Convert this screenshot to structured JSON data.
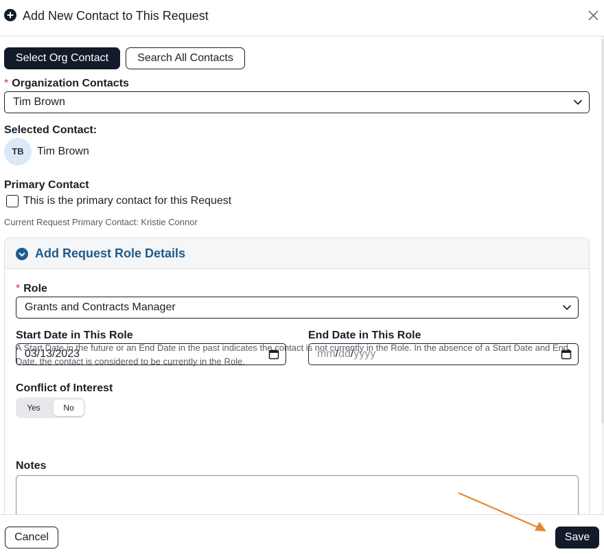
{
  "header": {
    "title": "Add New Contact to This Request",
    "plus_icon": "plus-circle-icon",
    "close_icon": "close-icon"
  },
  "tabs": {
    "select_org": "Select Org Contact",
    "search_all": "Search All Contacts"
  },
  "org_contacts": {
    "required_mark": "*",
    "label": "Organization Contacts",
    "value": "Tim Brown"
  },
  "selected_contact": {
    "label": "Selected Contact:",
    "initials": "TB",
    "name": "Tim Brown"
  },
  "primary_contact": {
    "label": "Primary Contact",
    "checkbox_label": "This is the primary contact for this Request",
    "checked": false,
    "current_note": "Current Request Primary Contact: Kristie Connor"
  },
  "role_details": {
    "title": "Add Request Role Details",
    "role_required_mark": "*",
    "role_label": "Role",
    "role_value": "Grants and Contracts Manager",
    "start_label": "Start Date in This Role",
    "start_value": "03/13/2023",
    "end_label": "End Date in This Role",
    "end_placeholder_mm": "mm",
    "end_placeholder_dd": "dd",
    "end_placeholder_yyyy": "yyyy",
    "end_sep": "/",
    "help_text": "A Start Date in the future or an End Date in the past indicates the contact is not currently in the Role. In the absence of a Start Date and End Date, the contact is considered to be currently in the Role.",
    "conflict_label": "Conflict of Interest",
    "conflict_yes": "Yes",
    "conflict_no": "No",
    "conflict_selected": "No",
    "notes_label": "Notes",
    "notes_value": ""
  },
  "footer": {
    "cancel": "Cancel",
    "save": "Save"
  },
  "colors": {
    "primary_dark": "#111b29",
    "accent_blue": "#1f5a8c",
    "required_red": "#d02f2f",
    "annotation_arrow": "#e8842c"
  }
}
